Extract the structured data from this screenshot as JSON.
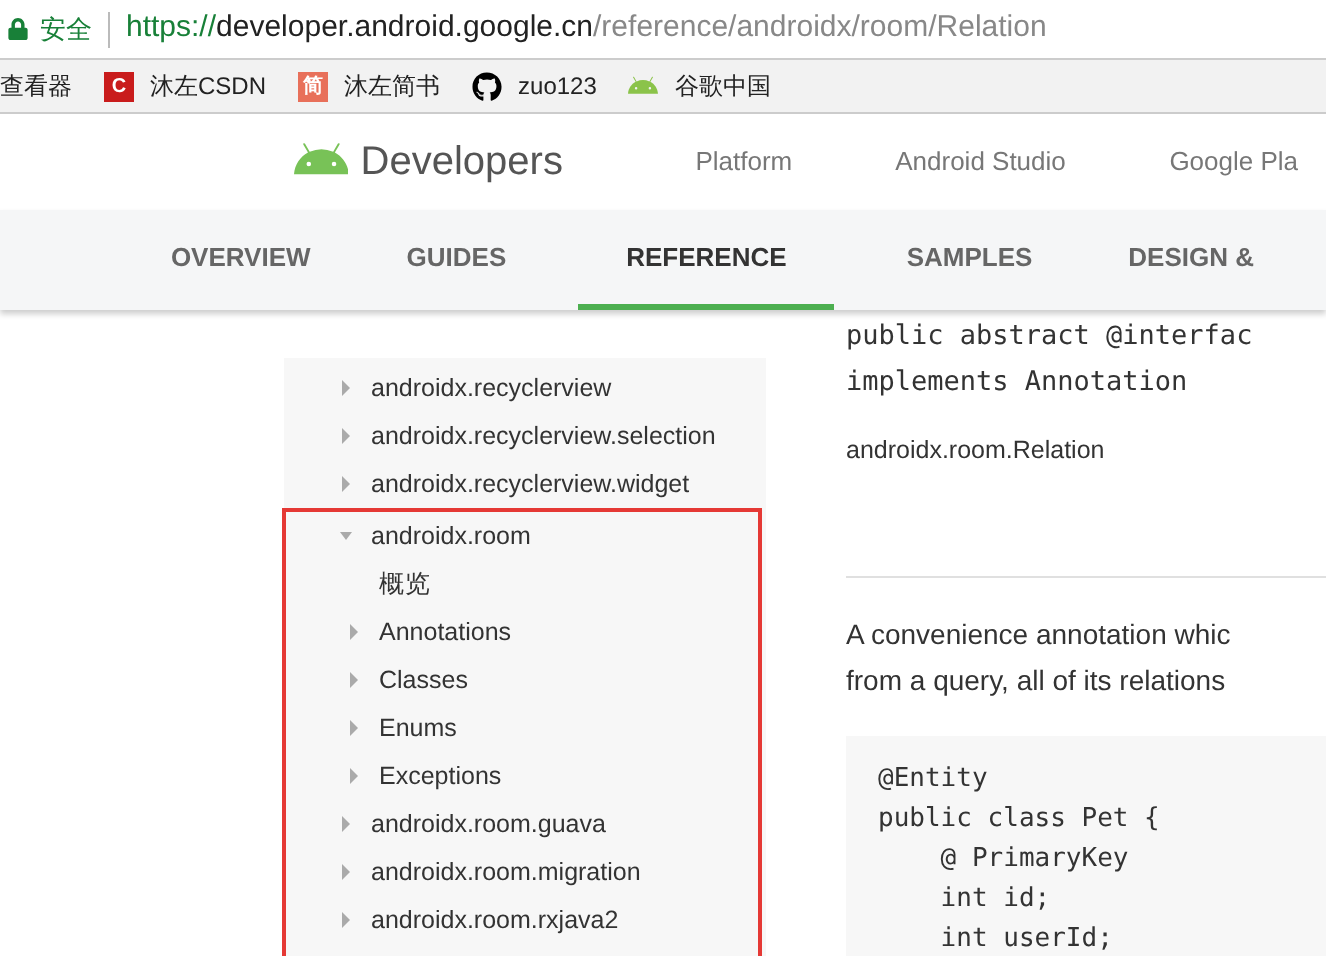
{
  "address_bar": {
    "security": "安全",
    "url_scheme": "https://",
    "url_host": "developer.android.google.cn",
    "url_path": "/reference/androidx/room/Relation"
  },
  "bookmarks": [
    {
      "label": "查看器",
      "kind": "plain"
    },
    {
      "label": "沐左CSDN",
      "kind": "letter",
      "badge": "C",
      "color": "#c91c1c"
    },
    {
      "label": "沐左简书",
      "kind": "letter",
      "badge": "简",
      "color": "#e8705a"
    },
    {
      "label": "zuo123",
      "kind": "github"
    },
    {
      "label": "谷歌中国",
      "kind": "android"
    }
  ],
  "header": {
    "logo": "Developers",
    "links": [
      "Platform",
      "Android Studio",
      "Google Pla"
    ]
  },
  "tabs": [
    {
      "label": "OVERVIEW",
      "selected": false
    },
    {
      "label": "GUIDES",
      "selected": false
    },
    {
      "label": "REFERENCE",
      "selected": true
    },
    {
      "label": "SAMPLES",
      "selected": false
    },
    {
      "label": "DESIGN &",
      "selected": false
    }
  ],
  "nav": [
    {
      "label": "androidx.recyclerview",
      "expanded": false,
      "highlighted": false
    },
    {
      "label": "androidx.recyclerview.selection",
      "expanded": false,
      "highlighted": false
    },
    {
      "label": "androidx.recyclerview.widget",
      "expanded": false,
      "highlighted": false
    },
    {
      "label": "androidx.room",
      "expanded": true,
      "highlighted": true,
      "children": [
        {
          "label": "概览"
        },
        {
          "label": "Annotations",
          "expanded": false
        },
        {
          "label": "Classes",
          "expanded": false
        },
        {
          "label": "Enums",
          "expanded": false
        },
        {
          "label": "Exceptions",
          "expanded": false
        }
      ]
    },
    {
      "label": "androidx.room.guava",
      "expanded": false,
      "highlighted": true
    },
    {
      "label": "androidx.room.migration",
      "expanded": false,
      "highlighted": true
    },
    {
      "label": "androidx.room.rxjava2",
      "expanded": false,
      "highlighted": true
    }
  ],
  "content": {
    "signature": [
      "public abstract @interfac",
      "implements Annotation"
    ],
    "qualified_name": "androidx.room.Relation",
    "description": [
      "A convenience annotation whic",
      "from a query, all of its relations"
    ],
    "code": [
      "@Entity",
      "public class Pet {",
      "    @ PrimaryKey",
      "    int id;",
      "    int userId;"
    ]
  }
}
